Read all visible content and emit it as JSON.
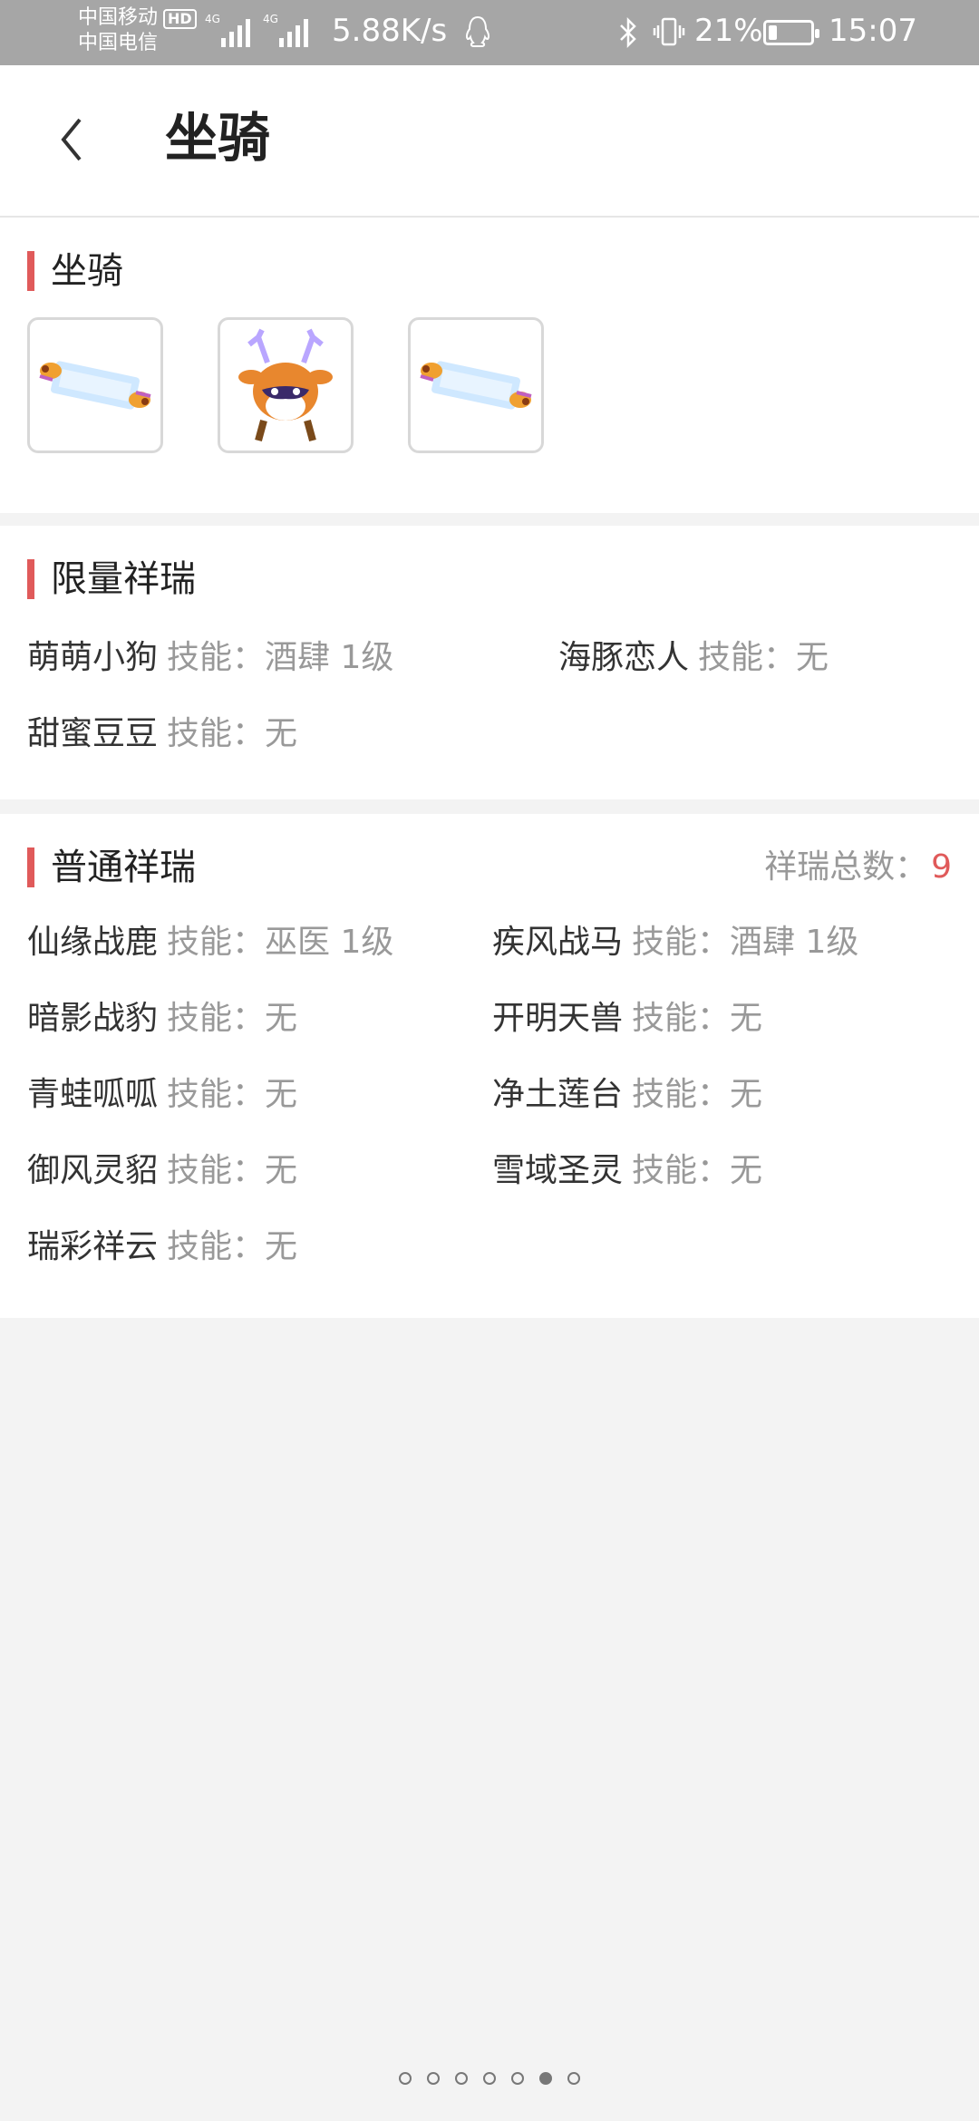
{
  "status_bar": {
    "carrier1": "中国移动",
    "carrier2": "中国电信",
    "hd": "HD",
    "net_tag": "4G",
    "speed": "5.88K/s",
    "battery_percent": "21%",
    "battery_level": 0.21,
    "time": "15:07"
  },
  "header": {
    "title": "坐骑"
  },
  "mount_section": {
    "title": "坐骑",
    "items": [
      {
        "icon": "scroll-icon"
      },
      {
        "icon": "deer-icon"
      },
      {
        "icon": "scroll-icon"
      }
    ]
  },
  "limited": {
    "title": "限量祥瑞",
    "entries": [
      {
        "name": "萌萌小狗",
        "skill_label": "技能：",
        "skill": "酒肆 1级"
      },
      {
        "name": "海豚恋人",
        "skill_label": "技能：",
        "skill": "无"
      },
      {
        "name": "甜蜜豆豆",
        "skill_label": "技能：",
        "skill": "无"
      }
    ]
  },
  "normal": {
    "title": "普通祥瑞",
    "count_label": "祥瑞总数：",
    "count": "9",
    "entries": [
      {
        "name": "仙缘战鹿",
        "skill_label": "技能：",
        "skill": "巫医 1级"
      },
      {
        "name": "疾风战马",
        "skill_label": "技能：",
        "skill": "酒肆 1级"
      },
      {
        "name": "暗影战豹",
        "skill_label": "技能：",
        "skill": "无"
      },
      {
        "name": "开明天兽",
        "skill_label": "技能：",
        "skill": "无"
      },
      {
        "name": "青蛙呱呱",
        "skill_label": "技能：",
        "skill": "无"
      },
      {
        "name": "净土莲台",
        "skill_label": "技能：",
        "skill": "无"
      },
      {
        "name": "御风灵貂",
        "skill_label": "技能：",
        "skill": "无"
      },
      {
        "name": "雪域圣灵",
        "skill_label": "技能：",
        "skill": "无"
      },
      {
        "name": "瑞彩祥云",
        "skill_label": "技能：",
        "skill": "无"
      }
    ]
  },
  "pager": {
    "total": 7,
    "active_index": 5
  },
  "colors": {
    "accent": "#e05a5a",
    "status_bar": "#a6a6a6"
  }
}
